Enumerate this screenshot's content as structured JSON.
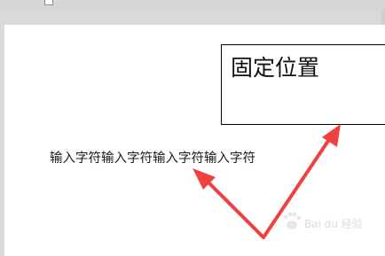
{
  "document": {
    "textbox_text": "固定位置",
    "body_text": "输入字符输入字符输入字符输入字符"
  },
  "annotations": {
    "arrow_color": "#f04040",
    "arrow_count": 2
  },
  "watermark": {
    "text": "Bai du 经验",
    "icon": "baidu-paw-icon"
  }
}
